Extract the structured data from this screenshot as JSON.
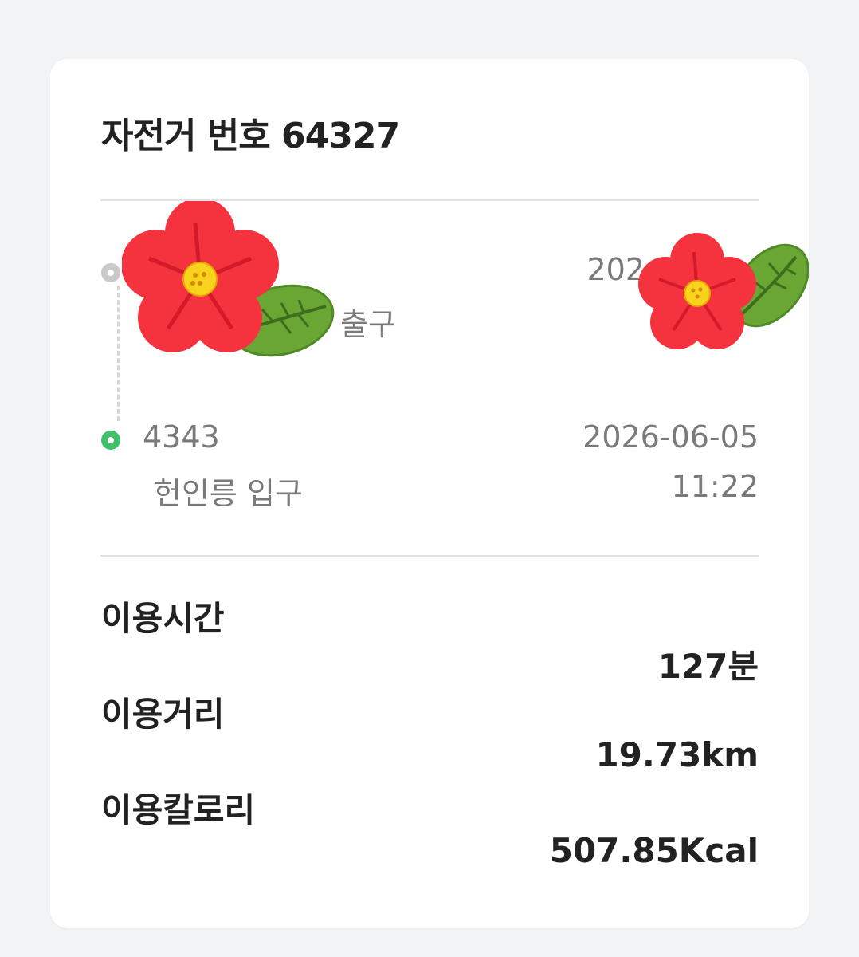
{
  "bike": {
    "title": "자전거 번호 64327"
  },
  "route": {
    "start": {
      "code": "",
      "name": "출구",
      "date": "202",
      "time": ""
    },
    "end": {
      "code": "4343",
      "name": "헌인릉 입구",
      "date": "2026-06-05",
      "time": "11:22"
    }
  },
  "stats": {
    "time_label": "이용시간",
    "time_value": "127분",
    "distance_label": "이용거리",
    "distance_value": "19.73km",
    "calorie_label": "이용칼로리",
    "calorie_value": "507.85Kcal"
  },
  "colors": {
    "end_dot": "#3fc16c",
    "start_dot": "#c9c9c9",
    "flower": "#f5333f",
    "leaf": "#6aa633"
  },
  "icons": {
    "start": "start-station-dot-icon",
    "end": "end-station-dot-icon",
    "sticker": "flower-sticker-icon"
  }
}
